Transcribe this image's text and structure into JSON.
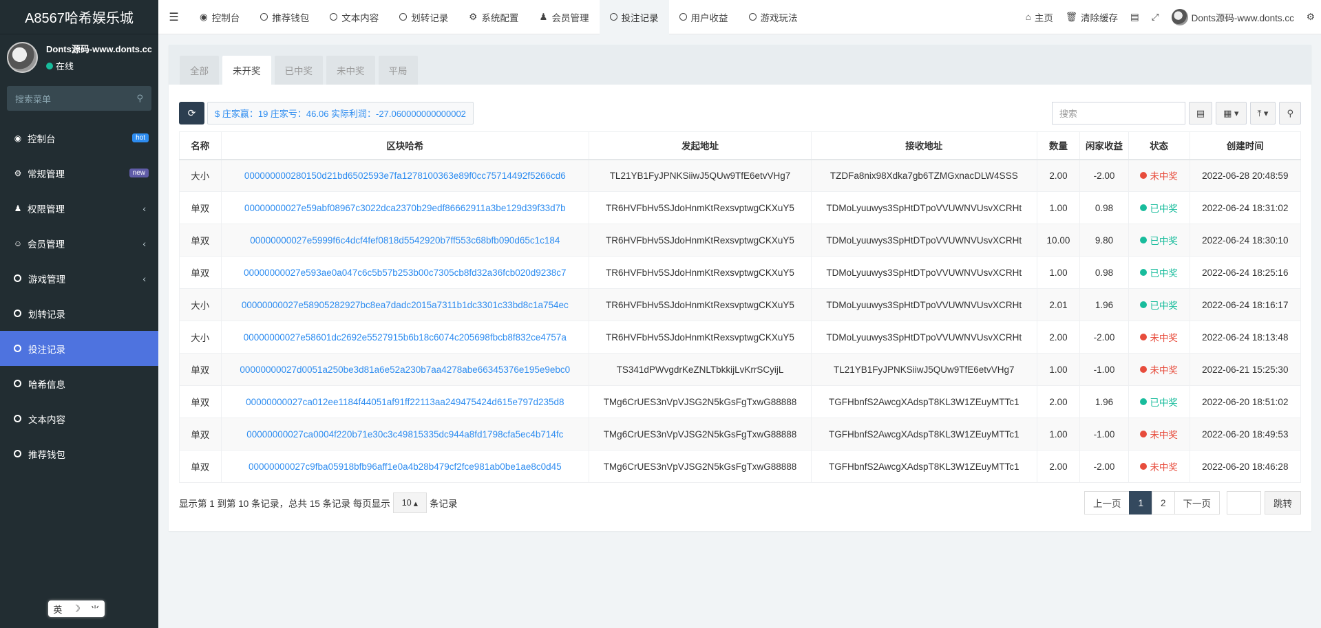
{
  "brand": "A8567哈希娱乐城",
  "user": {
    "name": "Donts源码-www.donts.cc",
    "status": "在线"
  },
  "sidebar": {
    "search_placeholder": "搜索菜单",
    "items": [
      {
        "label": "控制台",
        "badge": "hot"
      },
      {
        "label": "常规管理",
        "badge": "new"
      },
      {
        "label": "权限管理"
      },
      {
        "label": "会员管理"
      },
      {
        "label": "游戏管理"
      },
      {
        "label": "划转记录"
      },
      {
        "label": "投注记录"
      },
      {
        "label": "哈希信息"
      },
      {
        "label": "文本内容"
      },
      {
        "label": "推荐钱包"
      }
    ],
    "ime": {
      "a": "英",
      "b": "☽",
      "c": "⺌"
    }
  },
  "topnav": {
    "tabs": [
      "控制台",
      "推荐钱包",
      "文本内容",
      "划转记录",
      "系统配置",
      "会员管理",
      "投注记录",
      "用户收益",
      "游戏玩法"
    ],
    "home": "主页",
    "clear_cache": "清除缓存",
    "user": "Donts源码-www.donts.cc"
  },
  "filter_tabs": [
    "全部",
    "未开奖",
    "已中奖",
    "未中奖",
    "平局"
  ],
  "stats": "$ 庄家赢：19 庄家亏：46.06 实际利润：-27.060000000000002",
  "search_placeholder": "搜索",
  "table": {
    "headers": [
      "名称",
      "区块哈希",
      "发起地址",
      "接收地址",
      "数量",
      "闲家收益",
      "状态",
      "创建时间"
    ],
    "rows": [
      [
        "大小",
        "000000000280150d21bd6502593e7fa1278100363e89f0cc75714492f5266cd6",
        "TL21YB1FyJPNKSiiwJ5QUw9TfE6etvVHg7",
        "TZDFa8nix98Xdka7gb6TZMGxnacDLW4SSS",
        "2.00",
        "-2.00",
        "未中奖",
        "2022-06-28 20:48:59"
      ],
      [
        "单双",
        "00000000027e59abf08967c3022dca2370b29edf86662911a3be129d39f33d7b",
        "TR6HVFbHv5SJdoHnmKtRexsvptwgCKXuY5",
        "TDMoLyuuwys3SpHtDTpoVVUWNVUsvXCRHt",
        "1.00",
        "0.98",
        "已中奖",
        "2022-06-24 18:31:02"
      ],
      [
        "单双",
        "00000000027e5999f6c4dcf4fef0818d5542920b7ff553c68bfb090d65c1c184",
        "TR6HVFbHv5SJdoHnmKtRexsvptwgCKXuY5",
        "TDMoLyuuwys3SpHtDTpoVVUWNVUsvXCRHt",
        "10.00",
        "9.80",
        "已中奖",
        "2022-06-24 18:30:10"
      ],
      [
        "单双",
        "00000000027e593ae0a047c6c5b57b253b00c7305cb8fd32a36fcb020d9238c7",
        "TR6HVFbHv5SJdoHnmKtRexsvptwgCKXuY5",
        "TDMoLyuuwys3SpHtDTpoVVUWNVUsvXCRHt",
        "1.00",
        "0.98",
        "已中奖",
        "2022-06-24 18:25:16"
      ],
      [
        "大小",
        "00000000027e58905282927bc8ea7dadc2015a7311b1dc3301c33bd8c1a754ec",
        "TR6HVFbHv5SJdoHnmKtRexsvptwgCKXuY5",
        "TDMoLyuuwys3SpHtDTpoVVUWNVUsvXCRHt",
        "2.01",
        "1.96",
        "已中奖",
        "2022-06-24 18:16:17"
      ],
      [
        "大小",
        "00000000027e58601dc2692e5527915b6b18c6074c205698fbcb8f832ce4757a",
        "TR6HVFbHv5SJdoHnmKtRexsvptwgCKXuY5",
        "TDMoLyuuwys3SpHtDTpoVVUWNVUsvXCRHt",
        "2.00",
        "-2.00",
        "未中奖",
        "2022-06-24 18:13:48"
      ],
      [
        "单双",
        "00000000027d0051a250be3d81a6e52a230b7aa4278abe66345376e195e9ebc0",
        "TS341dPWvgdrKeZNLTbkkijLvKrrSCyijL",
        "TL21YB1FyJPNKSiiwJ5QUw9TfE6etvVHg7",
        "1.00",
        "-1.00",
        "未中奖",
        "2022-06-21 15:25:30"
      ],
      [
        "单双",
        "00000000027ca012ee1184f44051af91ff22113aa249475424d615e797d235d8",
        "TMg6CrUES3nVpVJSG2N5kGsFgTxwG88888",
        "TGFHbnfS2AwcgXAdspT8KL3W1ZEuyMTTc1",
        "2.00",
        "1.96",
        "已中奖",
        "2022-06-20 18:51:02"
      ],
      [
        "单双",
        "00000000027ca0004f220b71e30c3c49815335dc944a8fd1798cfa5ec4b714fc",
        "TMg6CrUES3nVpVJSG2N5kGsFgTxwG88888",
        "TGFHbnfS2AwcgXAdspT8KL3W1ZEuyMTTc1",
        "1.00",
        "-1.00",
        "未中奖",
        "2022-06-20 18:49:53"
      ],
      [
        "单双",
        "00000000027c9fba05918bfb96aff1e0a4b28b479cf2fce981ab0be1ae8c0d45",
        "TMg6CrUES3nVpVJSG2N5kGsFgTxwG88888",
        "TGFHbnfS2AwcgXAdspT8KL3W1ZEuyMTTc1",
        "2.00",
        "-2.00",
        "未中奖",
        "2022-06-20 18:46:28"
      ]
    ]
  },
  "pagination": {
    "summary": "显示第 1 到第 10 条记录，总共 15 条记录 每页显示",
    "page_size": "10",
    "suffix": "条记录",
    "prev": "上一页",
    "pages": [
      "1",
      "2"
    ],
    "next": "下一页",
    "go": "跳转"
  },
  "colors": {
    "sidebar": "#222d32",
    "active": "#4e73df",
    "link": "#2d8cf0",
    "win": "#18bc9c",
    "lose": "#e74c3c"
  }
}
